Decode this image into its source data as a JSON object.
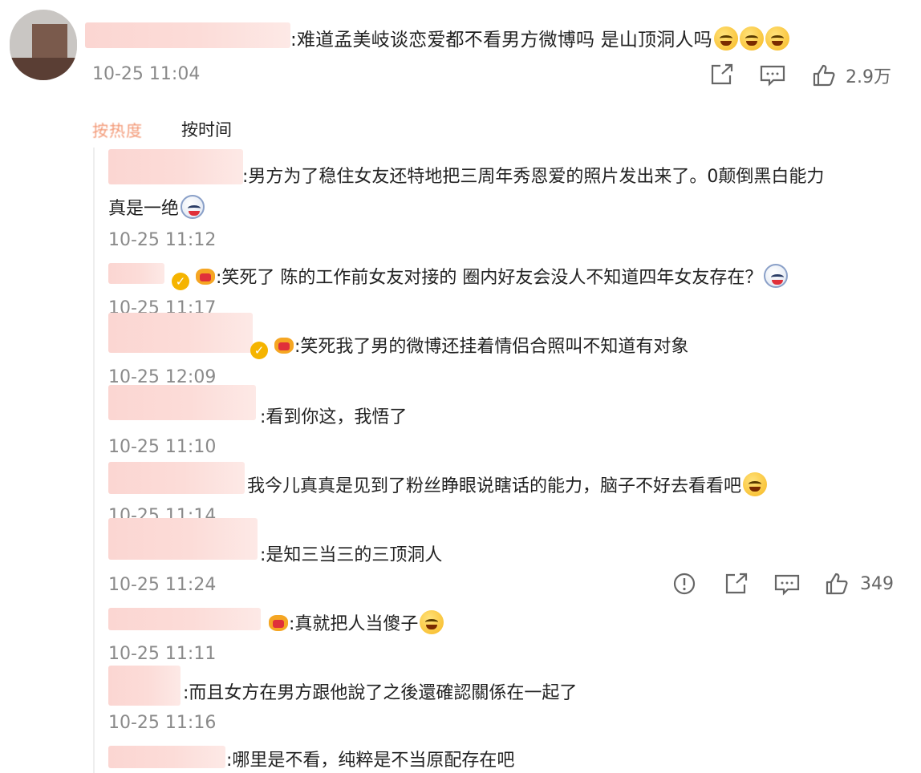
{
  "main_comment": {
    "text": ":难道孟美岐谈恋爱都不看男方微博吗 是山顶洞人吗",
    "time": "10-25 11:04",
    "likes": "2.9万",
    "icons": [
      "share-icon",
      "comment-icon",
      "like-icon"
    ]
  },
  "tabs": {
    "hot": "按热度",
    "time": "按时间"
  },
  "replies": [
    {
      "line1": ":男方为了稳住女友还特地把三周年秀恩爱的照片发出来了。0颠倒黑白能力",
      "line2": "真是一绝",
      "time": "10-25 11:12"
    },
    {
      "text": ":笑死了 陈的工作前女友对接的 圈内好友会没人不知道四年女友存在？",
      "time": "10-25 11:17"
    },
    {
      "text": ":笑死我了男的微博还挂着情侣合照叫不知道有对象",
      "time": "10-25 12:09"
    },
    {
      "text": ":看到你这，我悟了",
      "time": "10-25 11:10"
    },
    {
      "text": "我今儿真真是见到了粉丝睁眼说瞎话的能力，脑子不好去看看吧",
      "time": "10-25 11:14"
    },
    {
      "text": ":是知三当三的三顶洞人",
      "time": "10-25 11:24",
      "likes": "349"
    },
    {
      "text": ":真就把人当傻子",
      "time": "10-25 11:11"
    },
    {
      "text": ":而且女方在男方跟他說了之後還確認關係在一起了",
      "time": "10-25 11:16"
    },
    {
      "text": ":哪里是不看，纯粹是不当原配存在吧"
    }
  ],
  "colors": {
    "redact": "#fcdcd8",
    "time_gray": "#8a8a8a",
    "hot_tab": "#f39a78",
    "vip_badge": "#f5b400"
  }
}
